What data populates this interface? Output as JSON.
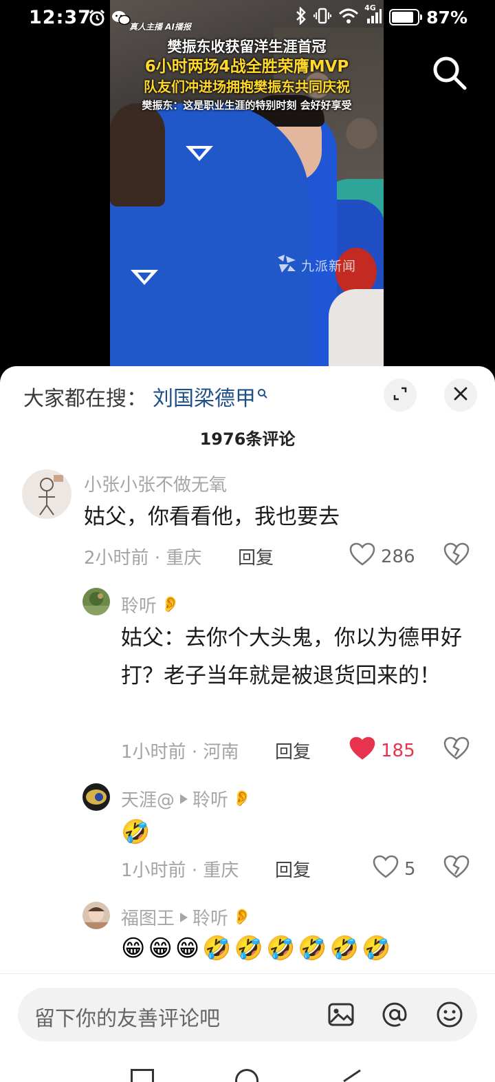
{
  "status_bar": {
    "time": "12:37",
    "network": "4G",
    "battery_percent": "87%",
    "battery_level": 0.87
  },
  "video": {
    "top_tag": "真人主播 AI播报",
    "headline_line1": "樊振东收获留洋生涯首冠",
    "headline_line2": "6小时两场4战全胜荣膺MVP",
    "headline_line3": "队友们冲进场拥抱樊振东共同庆祝",
    "headline_line4": "樊振东：这是职业生涯的特别时刻 会好好享受",
    "watermark": "九派新闻"
  },
  "sheet": {
    "trending_label": "大家都在搜：",
    "trending_query": "刘国梁德甲",
    "comment_count_title": "1976条评论"
  },
  "comments": [
    {
      "user": "小张小张不做无氧",
      "text": "姑父，你看看他，我也要去",
      "time": "2小时前",
      "location": "重庆",
      "reply_label": "回复",
      "likes": "286",
      "liked": false
    },
    {
      "user": "聆听",
      "user_emoji": "👂",
      "text": "姑父：去你个大头鬼，你以为德甲好打？老子当年就是被退货回来的！",
      "time": "1小时前",
      "location": "河南",
      "reply_label": "回复",
      "likes": "185",
      "liked": true
    },
    {
      "user": "天涯@",
      "reply_to": "聆听",
      "user_emoji": "👂",
      "text": "🤣",
      "time": "1小时前",
      "location": "重庆",
      "reply_label": "回复",
      "likes": "5",
      "liked": false
    },
    {
      "user": "福图王",
      "reply_to": "聆听",
      "user_emoji": "👂",
      "emojis": [
        "😁",
        "😁",
        "😁",
        "🤣",
        "🤣",
        "🤣",
        "🤣",
        "🤣",
        "🤣"
      ]
    }
  ],
  "input": {
    "placeholder": "留下你的友善评论吧"
  },
  "colors": {
    "like_active": "#e8334f",
    "trending_query": "#1e4f86",
    "headline_yellow": "#ffd82a",
    "jersey_blue": "#2158c9"
  },
  "icons": [
    "alarm-icon",
    "wechat-icon",
    "bluetooth-icon",
    "vibrate-icon",
    "wifi-icon",
    "signal-icon",
    "battery-icon",
    "search-icon",
    "expand-icon",
    "close-icon",
    "heart-icon",
    "heart-broken-icon",
    "image-icon",
    "at-icon",
    "emoji-icon"
  ]
}
